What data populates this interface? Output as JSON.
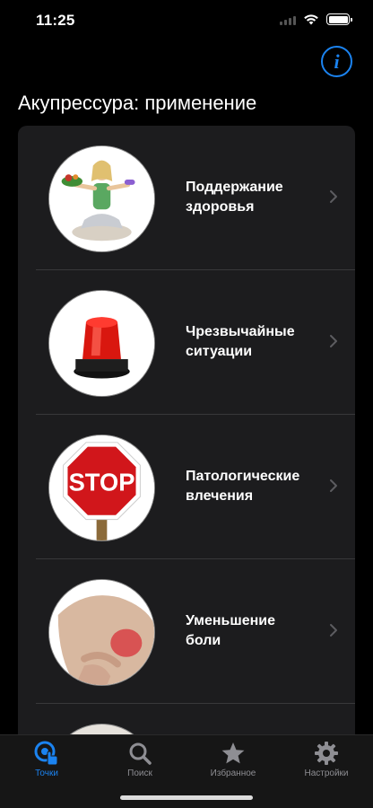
{
  "status": {
    "time": "11:25"
  },
  "header": {
    "title": "Акупрессура: применение",
    "info_icon": "info-icon",
    "info_glyph": "i"
  },
  "list": {
    "items": [
      {
        "label": "Поддержание\nздоровья",
        "icon": "meditating-woman-image"
      },
      {
        "label": "Чрезвычайные\nситуации",
        "icon": "red-siren-image"
      },
      {
        "label": "Патологические\nвлечения",
        "icon": "stop-sign-image",
        "sign_text": "STOP"
      },
      {
        "label": "Уменьшение\nболи",
        "icon": "back-pain-image"
      }
    ]
  },
  "tabbar": {
    "tabs": [
      {
        "label": "Точки",
        "icon": "points-icon",
        "active": true
      },
      {
        "label": "Поиск",
        "icon": "search-icon",
        "active": false
      },
      {
        "label": "Избранное",
        "icon": "star-icon",
        "active": false
      },
      {
        "label": "Настройки",
        "icon": "gear-icon",
        "active": false
      }
    ]
  },
  "colors": {
    "accent": "#1b83f0",
    "background": "#000000",
    "card": "#1c1c1e",
    "inactive": "#8e8e93"
  }
}
